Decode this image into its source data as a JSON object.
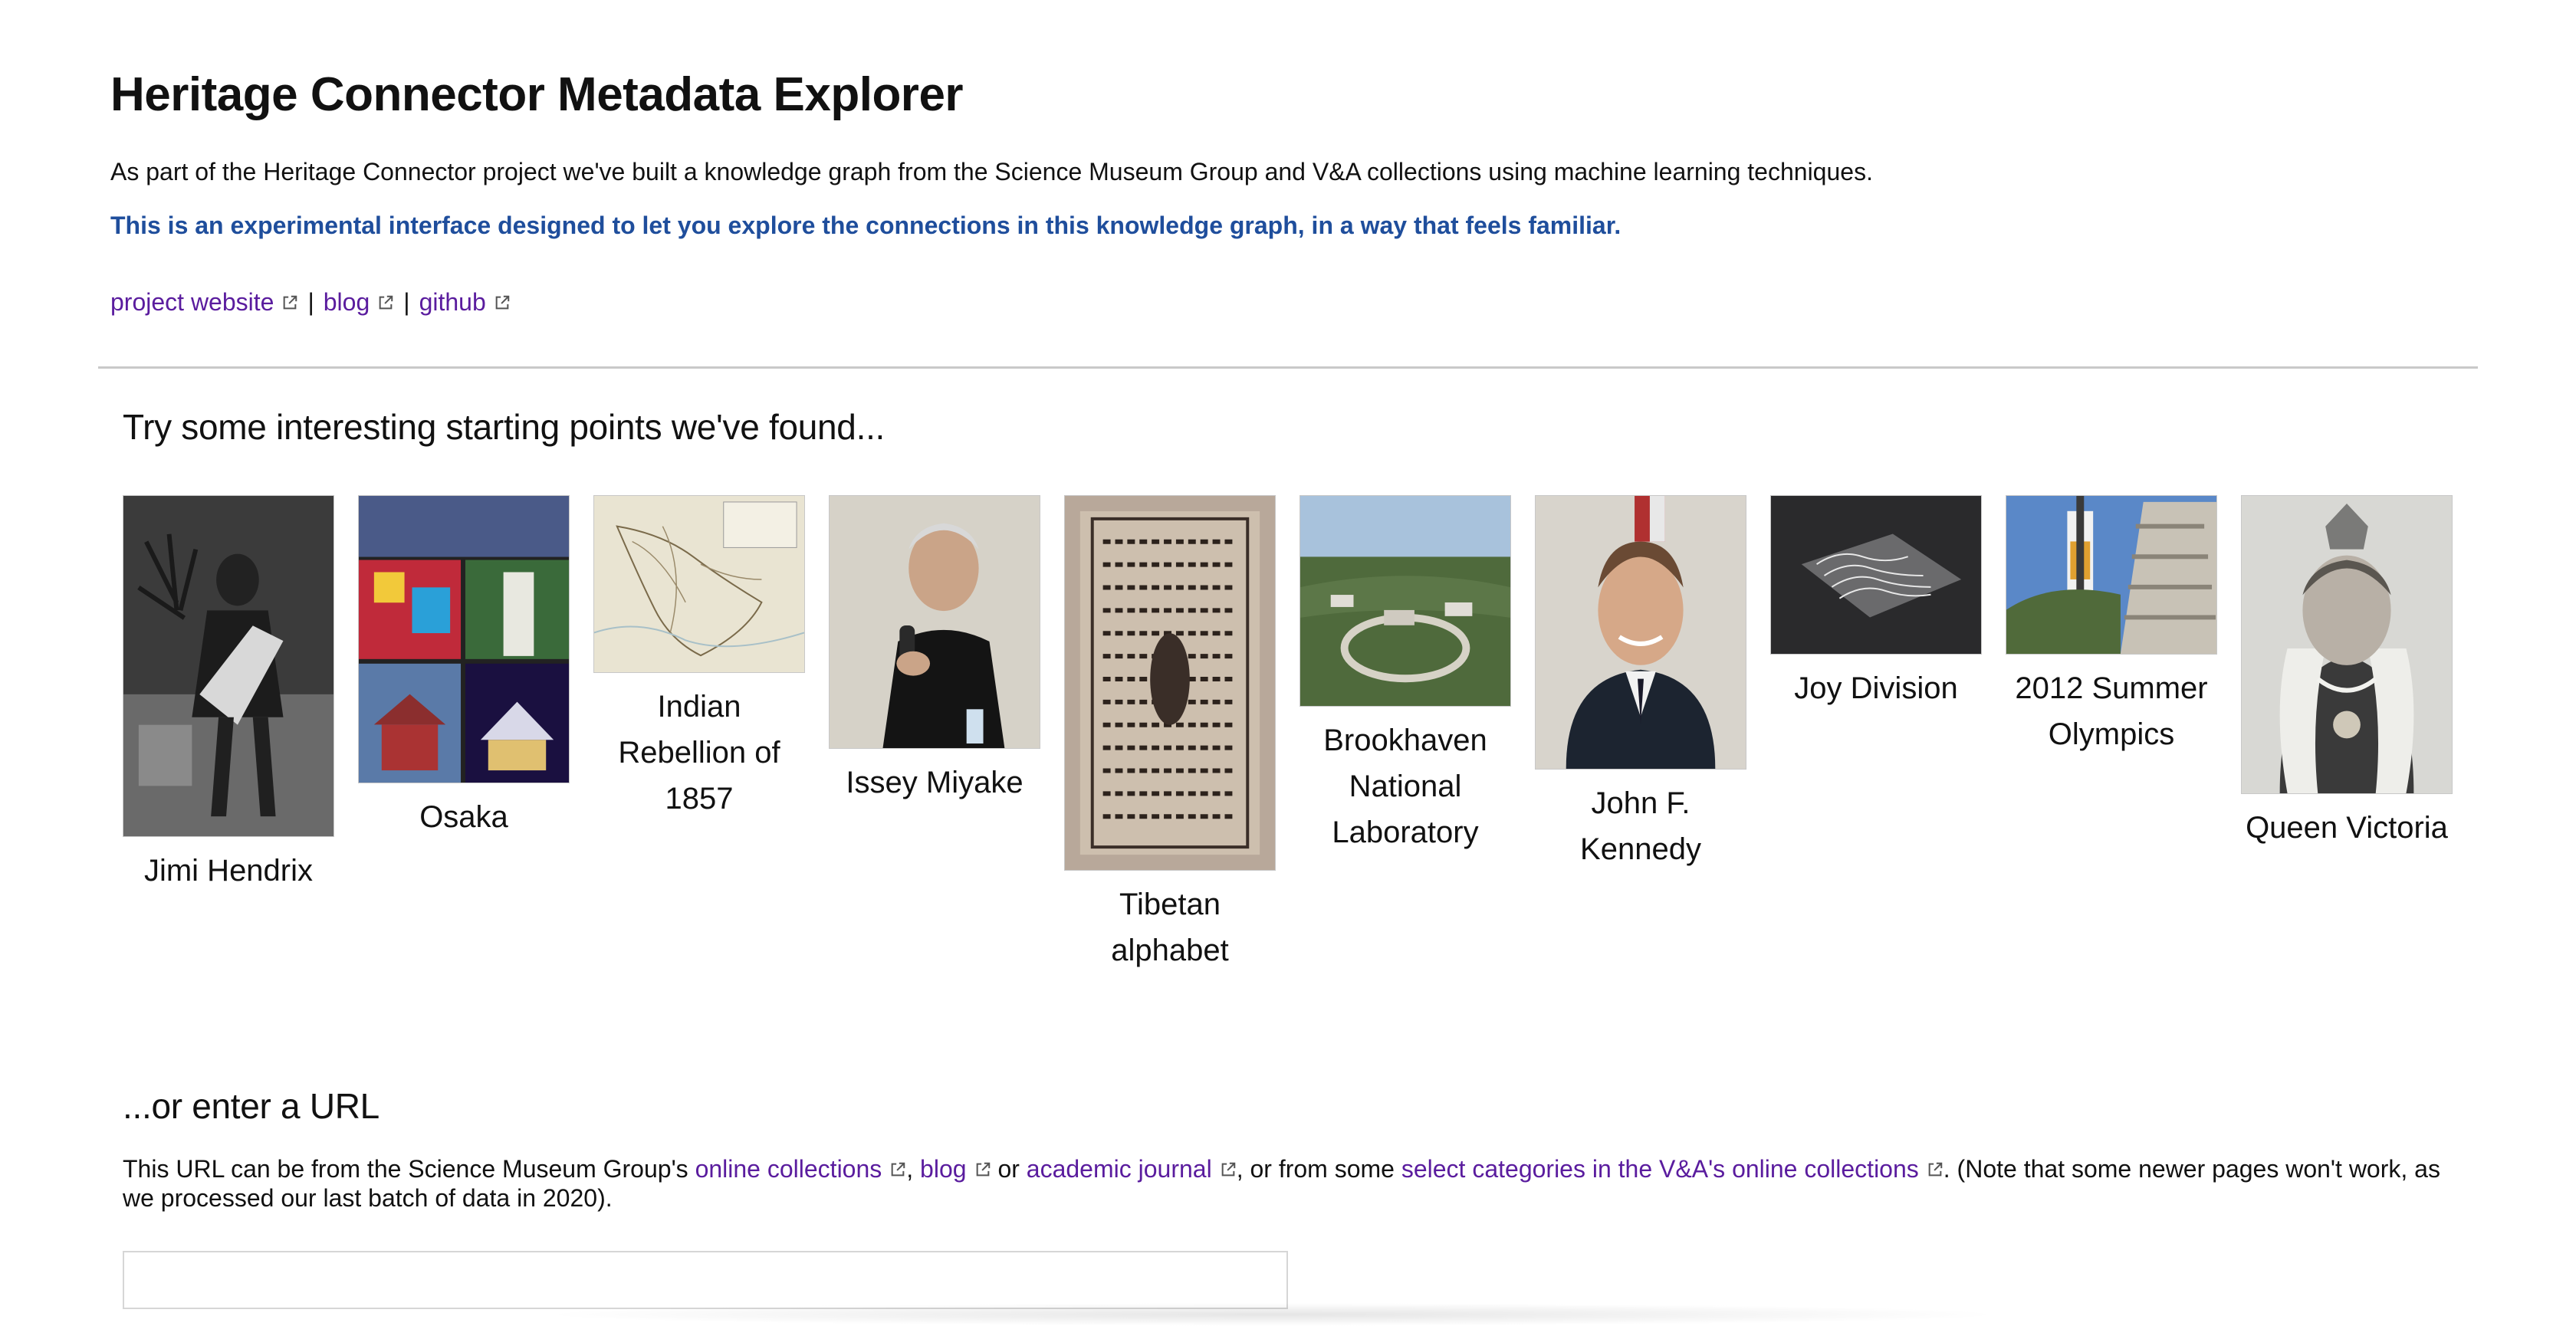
{
  "page": {
    "title": "Heritage Connector Metadata Explorer",
    "intro": "As part of the Heritage Connector project we've built a knowledge graph from the Science Museum Group and V&A collections using machine learning techniques.",
    "highlight": "This is an experimental interface designed to let you explore the connections in this knowledge graph, in a way that feels familiar.",
    "highlight_color": "#1f4e9c",
    "link_color": "#5a1c9e"
  },
  "links": {
    "project_website": "project website",
    "blog": "blog",
    "github": "github",
    "separator": "|"
  },
  "starting_points": {
    "title": "Try some interesting starting points we've found...",
    "items": [
      {
        "label": "Jimi Hendrix"
      },
      {
        "label": "Osaka"
      },
      {
        "label": "Indian Rebellion of 1857"
      },
      {
        "label": "Issey Miyake"
      },
      {
        "label": "Tibetan alphabet"
      },
      {
        "label": "Brookhaven National Laboratory"
      },
      {
        "label": "John F. Kennedy"
      },
      {
        "label": "Joy Division"
      },
      {
        "label": "2012 Summer Olympics"
      },
      {
        "label": "Queen Victoria"
      }
    ]
  },
  "url_section": {
    "title": "...or enter a URL",
    "note_prefix": "This URL can be from the Science Museum Group's ",
    "online_collections": "online collections",
    "comma": ", ",
    "blog": "blog",
    "or": " or ",
    "academic_journal": "academic journal",
    "note_middle": ", or from some ",
    "va_link": "select categories in the V&A's online collections",
    "note_suffix": ". (Note that some newer pages won't work, as we processed our last batch of data in 2020).",
    "input_value": "",
    "input_placeholder": ""
  }
}
